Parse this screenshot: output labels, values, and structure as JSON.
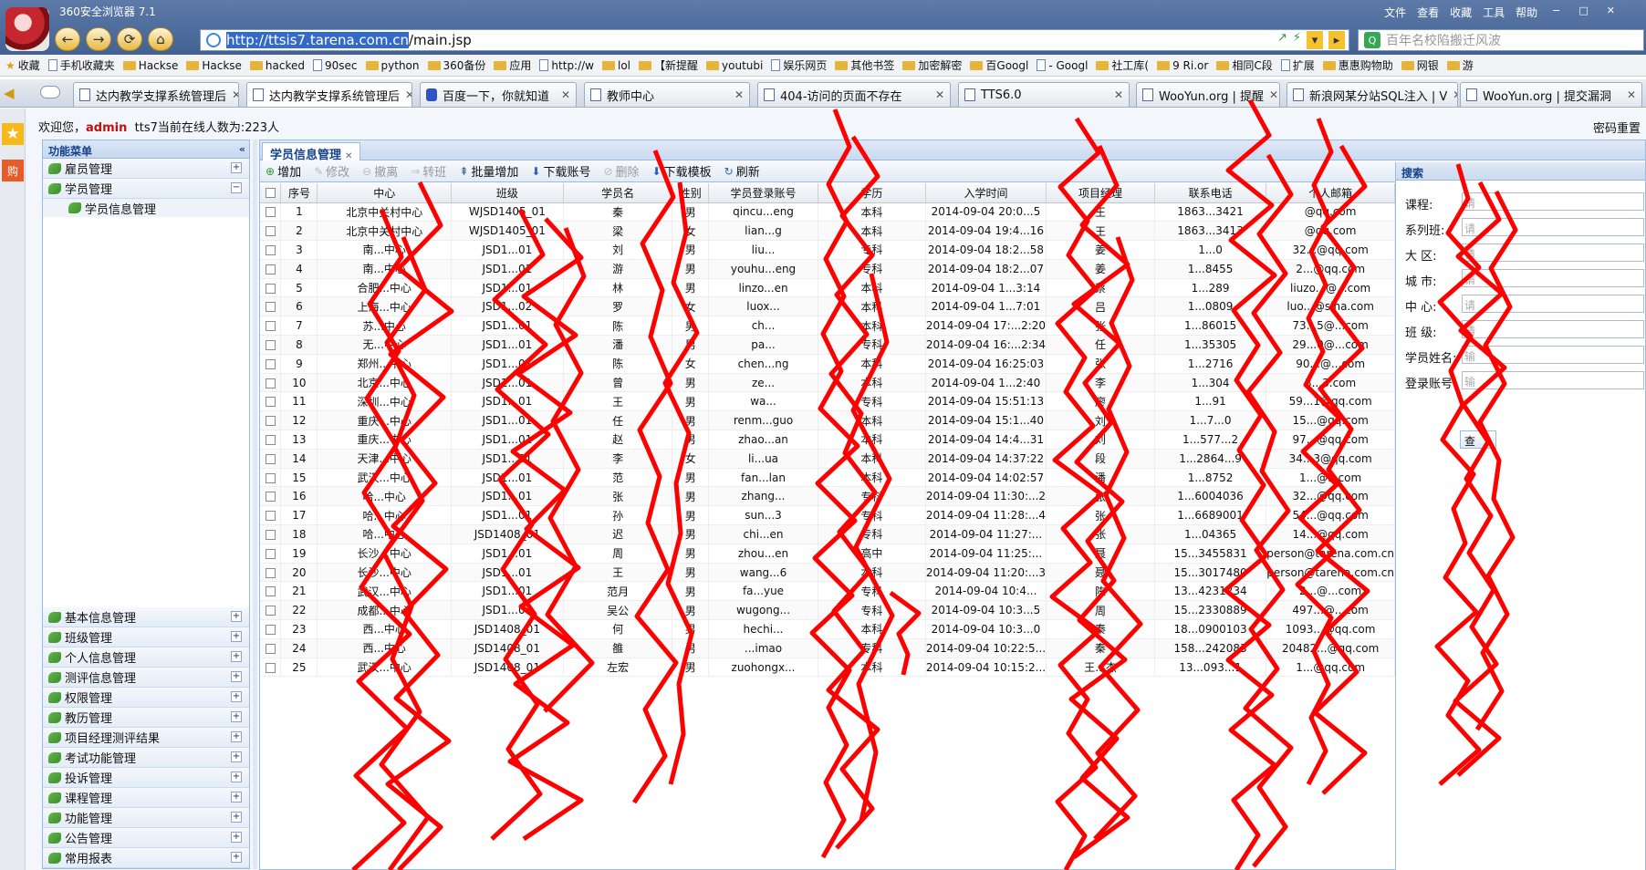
{
  "browser": {
    "title": "360安全浏览器 7.1",
    "menu": [
      "文件",
      "查看",
      "收藏",
      "工具",
      "帮助"
    ],
    "url_host": "http://ttsis7.tarena.com.cn",
    "url_path": "/main.jsp",
    "search_placeholder": "百年名校陷搬迁风波",
    "bookmarks": [
      "收藏",
      "手机收藏夹",
      "Hackse",
      "Hackse",
      "hacked",
      "90sec",
      "python",
      "360备份",
      "应用",
      "http://w",
      "lol",
      "【新提醒",
      "youtubi",
      "娱乐网页",
      "其他书签",
      "加密解密",
      "百Googl",
      "- Googl",
      "社工库(",
      "9 Ri.or",
      "相同C段",
      "扩展",
      "惠惠购物助",
      "网银",
      "游"
    ],
    "tabs": [
      {
        "label": "达内教学支撑系统管理后"
      },
      {
        "label": "达内教学支撑系统管理后"
      },
      {
        "label": "百度一下，你就知道"
      },
      {
        "label": "教师中心"
      },
      {
        "label": "404-访问的页面不存在"
      },
      {
        "label": "TTS6.0"
      },
      {
        "label": "WooYun.org | 提醒"
      },
      {
        "label": "新浪网某分站SQL注入 | V"
      },
      {
        "label": "WooYun.org | 提交漏洞"
      }
    ],
    "accent_color": "#3f5e8f"
  },
  "page": {
    "welcome_prefix": "欢迎您，",
    "user": "admin",
    "online": "tts7当前在线人数为:223人",
    "password_reset": "密码重置"
  },
  "menu": {
    "title": "功能菜单",
    "top_groups": [
      {
        "label": "雇员管理",
        "toggle": "+"
      },
      {
        "label": "学员管理",
        "toggle": "−"
      }
    ],
    "sub_item": "学员信息管理",
    "bottom_groups": [
      "基本信息管理",
      "班级管理",
      "个人信息管理",
      "测评信息管理",
      "权限管理",
      "教历管理",
      "项目经理测评结果",
      "考试功能管理",
      "投诉管理",
      "课程管理",
      "功能管理",
      "公告管理",
      "常用报表"
    ]
  },
  "content": {
    "tab_label": "学员信息管理",
    "toolbar": [
      {
        "label": "增加",
        "icon": "add-icon",
        "enabled": true
      },
      {
        "label": "修改",
        "icon": "edit-icon",
        "enabled": false
      },
      {
        "label": "撤离",
        "icon": "remove-icon",
        "enabled": false
      },
      {
        "label": "转班",
        "icon": "transfer-icon",
        "enabled": false
      },
      {
        "label": "批量增加",
        "icon": "batch-add-icon",
        "enabled": true
      },
      {
        "label": "下载账号",
        "icon": "download-icon",
        "enabled": true
      },
      {
        "label": "删除",
        "icon": "delete-icon",
        "enabled": false
      },
      {
        "label": "下载模板",
        "icon": "download-icon",
        "enabled": true
      },
      {
        "label": "刷新",
        "icon": "refresh-icon",
        "enabled": true
      }
    ],
    "columns": [
      "序号",
      "中心",
      "班级",
      "学员名",
      "性别",
      "学员登录账号",
      "学历",
      "入学时间",
      "项目经理",
      "联系电话",
      "个人邮箱"
    ],
    "rows": [
      [
        "1",
        "北京中关村中心",
        "WJSD1405_01",
        "秦",
        "男",
        "qincu...eng",
        "本科",
        "2014-09-04 20:0...5",
        "王",
        "1863...3421",
        "@qq.com"
      ],
      [
        "2",
        "北京中关村中心",
        "WJSD1405_01",
        "梁",
        "女",
        "lian...g",
        "本科",
        "2014-09-04 19:4...16",
        "王",
        "1863...3413",
        "@qq.com"
      ],
      [
        "3",
        "南...中心",
        "JSD1...01",
        "刘",
        "男",
        "liu...",
        "专科",
        "2014-09-04 18:2...58",
        "姜",
        "1...0",
        "32...@qq.com"
      ],
      [
        "4",
        "南...中心",
        "JSD1...01",
        "游",
        "男",
        "youhu...eng",
        "专科",
        "2014-09-04 18:2...07",
        "姜",
        "1...8455",
        "2...@qq.com"
      ],
      [
        "5",
        "合肥...中心",
        "JSD1...01",
        "林",
        "男",
        "linzo...en",
        "本科",
        "2014-09-04 1...3:14",
        "蔡",
        "1...289",
        "liuzo...@...com"
      ],
      [
        "6",
        "上海...中心",
        "JSD1...02",
        "罗",
        "女",
        "luox...",
        "本科",
        "2014-09-04 1...7:01",
        "吕",
        "1...0809",
        "luo...@sina.com"
      ],
      [
        "7",
        "苏...中心",
        "JSD1...01",
        "陈",
        "男",
        "ch...",
        "本科",
        "2014-09-04 17:...2:20",
        "张",
        "1...86015",
        "73...5@...com"
      ],
      [
        "8",
        "无...中心",
        "JSD1...01",
        "潘",
        "男",
        "pa...",
        "专科",
        "2014-09-04 16:...2:34",
        "任",
        "1...35305",
        "29...0@...com"
      ],
      [
        "9",
        "郑州...中心",
        "JSD1...01",
        "陈",
        "女",
        "chen...ng",
        "本科",
        "2014-09-04 16:25:03",
        "张",
        "1...2716",
        "90...@...com"
      ],
      [
        "10",
        "北京...中心",
        "JSD1...01",
        "曾",
        "男",
        "ze...",
        "本科",
        "2014-09-04 1...2:40",
        "李",
        "1...304",
        "3...3.com"
      ],
      [
        "11",
        "深圳...中心",
        "JSD1...01",
        "王",
        "男",
        "wa...",
        "专科",
        "2014-09-04 15:51:13",
        "廖",
        "1...91",
        "59...1@qq.com"
      ],
      [
        "12",
        "重庆...中心",
        "JSD1...01",
        "任",
        "男",
        "renm...guo",
        "本科",
        "2014-09-04 15:1...40",
        "刘",
        "1...7...0",
        "15...@qq.com"
      ],
      [
        "13",
        "重庆...中心",
        "JSD1...01",
        "赵",
        "男",
        "zhao...an",
        "本科",
        "2014-09-04 14:4...31",
        "刘",
        "1...577...2",
        "97...@qq.com"
      ],
      [
        "14",
        "天津...中心",
        "JSD1...01",
        "李",
        "女",
        "li...ua",
        "本科",
        "2014-09-04 14:37:22",
        "段",
        "1...2864...9",
        "34...3@qq.com"
      ],
      [
        "15",
        "武汉...中心",
        "JSD1...01",
        "范",
        "男",
        "fan...lan",
        "本科",
        "2014-09-04 14:02:57",
        "潘",
        "1...8752",
        "1...@...com"
      ],
      [
        "16",
        "哈...中心",
        "JSD1...01",
        "张",
        "男",
        "zhang...",
        "专科",
        "2014-09-04 11:30:...2",
        "张",
        "1...6004036",
        "32...@qq.com"
      ],
      [
        "17",
        "哈...中心",
        "JSD1...01",
        "孙",
        "男",
        "sun...3",
        "专科",
        "2014-09-04 11:28:...4",
        "张",
        "1...6689001",
        "54...@qq.com"
      ],
      [
        "18",
        "哈...中心",
        "JSD1408_01",
        "迟",
        "男",
        "chi...en",
        "专科",
        "2014-09-04 11:27:...",
        "张",
        "1...04365",
        "14...@qq.com"
      ],
      [
        "19",
        "长沙...中心",
        "JSD1...01",
        "周",
        "男",
        "zhou...en",
        "高中",
        "2014-09-04 11:25:...",
        "聂",
        "15...3455831",
        "person@tarena.com.cn"
      ],
      [
        "20",
        "长沙...中心",
        "JSD1...01",
        "王",
        "男",
        "wang...6",
        "本科",
        "2014-09-04 11:20:...3",
        "聂",
        "15...3017480",
        "person@tarena.com.cn"
      ],
      [
        "21",
        "武汉...中心",
        "JSD1...01",
        "范月",
        "男",
        "fa...yue",
        "专科",
        "2014-09-04 10:4...",
        "陈",
        "13...4231234",
        "2...@...com"
      ],
      [
        "22",
        "成都...中心",
        "JSD1...01",
        "吴公",
        "男",
        "wugong...",
        "专科",
        "2014-09-04 10:3...5",
        "周",
        "15...2330889",
        "497...@...com"
      ],
      [
        "23",
        "西...中心",
        "JSD1408_01",
        "何",
        "男",
        "hechi...",
        "本科",
        "2014-09-04 10:3...0",
        "秦",
        "18...0900103",
        "1093...@qq.com"
      ],
      [
        "24",
        "西...中心",
        "JSD1408_01",
        "雒",
        "男",
        "...imao",
        "专科",
        "2014-09-04 10:22:5...",
        "秦",
        "158...242083",
        "20482...@qq.com"
      ],
      [
        "25",
        "武汉...中心",
        "JSD1408_01",
        "左宏",
        "男",
        "zuohongx...",
        "本科",
        "2014-09-04 10:15:2...",
        "王...杰",
        "13...093...1",
        "1...@qq.com"
      ]
    ]
  },
  "search": {
    "title": "搜索",
    "fields": [
      {
        "label": "课程:",
        "placeholder": "请"
      },
      {
        "label": "系列班:",
        "placeholder": "请"
      },
      {
        "label": "大 区:",
        "placeholder": "请"
      },
      {
        "label": "城 市:",
        "placeholder": "请"
      },
      {
        "label": "中 心:",
        "placeholder": "请"
      },
      {
        "label": "班 级:",
        "placeholder": "请"
      },
      {
        "label": "学员姓名:",
        "placeholder": "输"
      },
      {
        "label": "登录账号:",
        "placeholder": "输"
      }
    ],
    "button": "查"
  },
  "overlay": {
    "scribble_color": "#ff0000"
  }
}
